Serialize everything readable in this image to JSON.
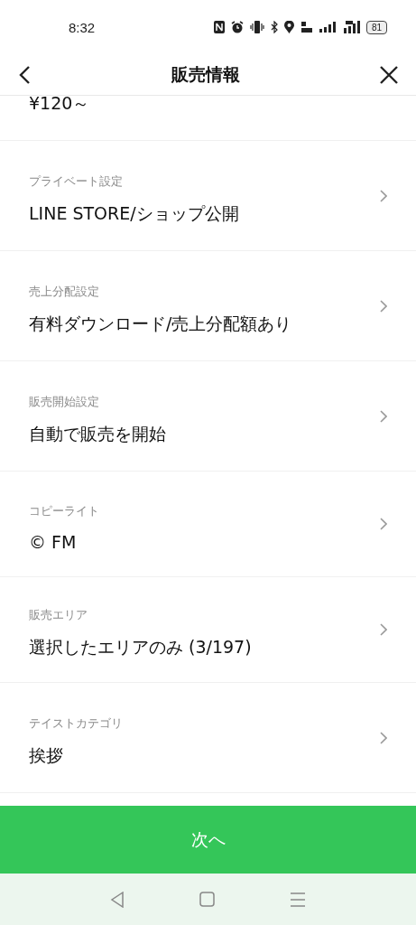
{
  "status_bar": {
    "time": "8:32",
    "battery": "81"
  },
  "header": {
    "title": "販売情報"
  },
  "partial_value": "¥120～",
  "settings": [
    {
      "label": "プライベート設定",
      "value": "LINE STORE/ショップ公開"
    },
    {
      "label": "売上分配設定",
      "value": "有料ダウンロード/売上分配額あり"
    },
    {
      "label": "販売開始設定",
      "value": "自動で販売を開始"
    },
    {
      "label": "コピーライト",
      "value": "© FM"
    },
    {
      "label": "販売エリア",
      "value": "選択したエリアのみ (3/197)"
    },
    {
      "label": "テイストカテゴリ",
      "value": "挨拶"
    }
  ],
  "next_button": "次へ"
}
